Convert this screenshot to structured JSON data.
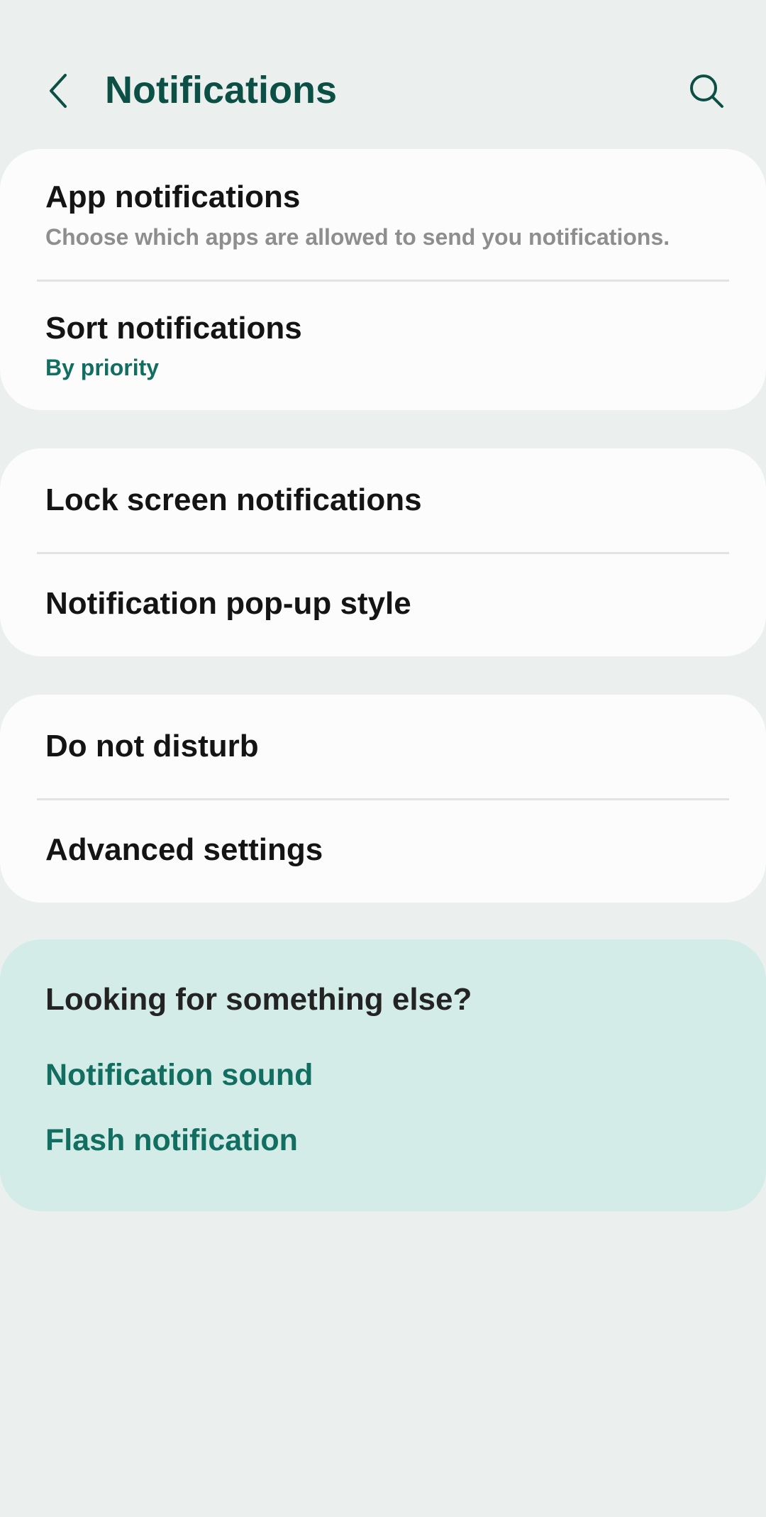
{
  "header": {
    "title": "Notifications"
  },
  "colors": {
    "background": "#ebf0ef",
    "card": "#fcfcfc",
    "accent": "#126e60",
    "title": "#0c5045",
    "suggest_bg": "#d3ece8"
  },
  "icons": {
    "back": "chevron-left-icon",
    "search": "search-icon"
  },
  "group1": {
    "app_notifications": {
      "title": "App notifications",
      "subtitle": "Choose which apps are allowed to send you notifications."
    },
    "sort_notifications": {
      "title": "Sort notifications",
      "value": "By priority"
    }
  },
  "group2": {
    "lock_screen": "Lock screen notifications",
    "popup_style": "Notification pop-up style"
  },
  "group3": {
    "do_not_disturb": "Do not disturb",
    "advanced": "Advanced settings"
  },
  "suggestions": {
    "title": "Looking for something else?",
    "links": [
      "Notification sound",
      "Flash notification"
    ]
  }
}
